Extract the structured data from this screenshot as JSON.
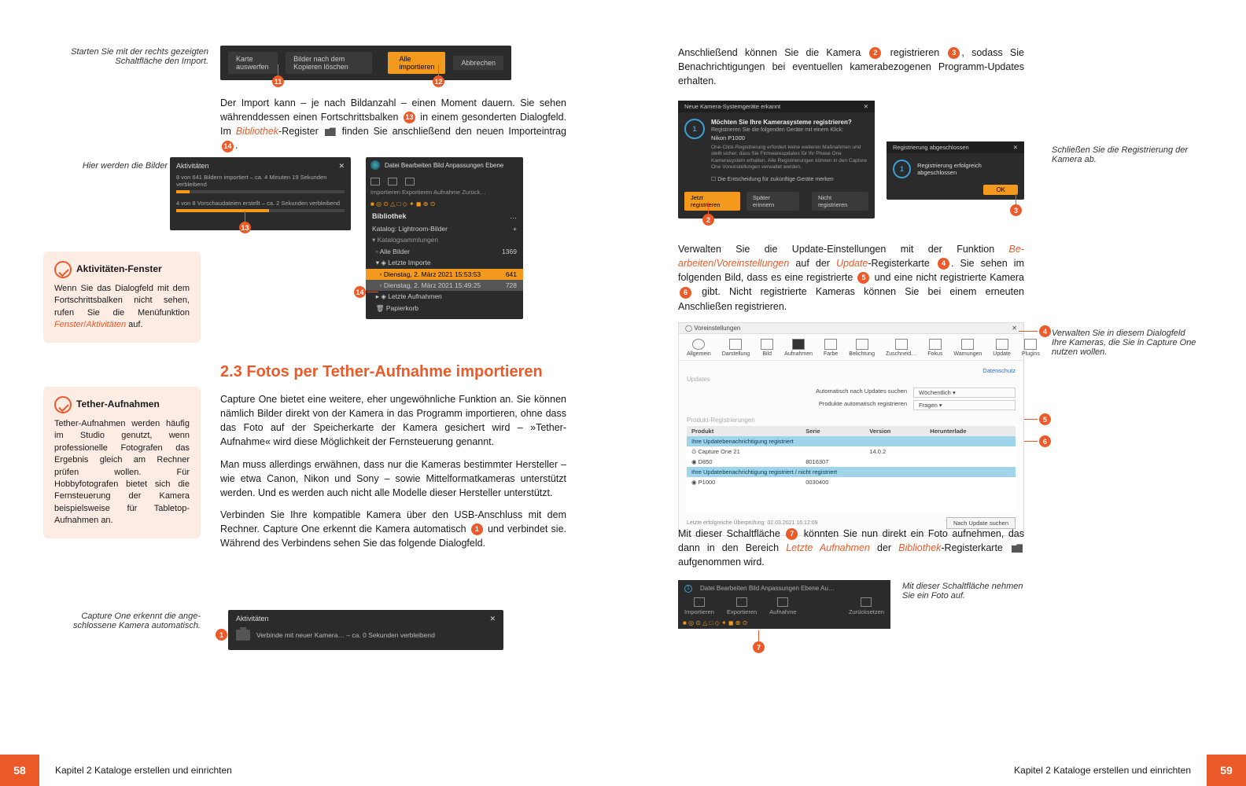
{
  "left": {
    "margin1": "Starten Sie mit der rechts gezeigten Schaltfläche den Import.",
    "margin2": "Hier werden die Bilder importiert.",
    "margin3": "Capture One erkennt die ange­schlossene Kamera automatisch.",
    "toolbar": {
      "b1": "Karte auswerfen",
      "b2": "Bilder nach dem Kopieren löschen",
      "b3": "Alle importieren",
      "b4": "Abbrechen"
    },
    "p1a": "Der Import kann – je nach Bildanzahl – einen Moment dauern. Sie sehen währenddessen einen Fortschrittsbalken ",
    "p1b": " in einem gesonderten Dialogfeld. Im ",
    "p1_lib": "Bibliothek",
    "p1c": "-Register ",
    "p1d": " finden Sie anschließend den neuen Importeintrag ",
    "activities": {
      "title": "Aktivitäten",
      "l1": "8 von 641 Bildern importiert – ca. 4 Minuten 19 Sekunden verbleibend",
      "l2": "4 von 8 Vorschaudateien erstellt – ca. 2 Sekunden verbleibend"
    },
    "library": {
      "menu": "Datei   Bearbeiten   Bild   Anpassungen   Ebene",
      "tabs": "Importieren  Exportieren  Aufnahme              Zurück…",
      "title": "Bibliothek",
      "kat": "Katalog: Lightroom-Bilder",
      "grp": "Katalogsammlungen",
      "r1": "Alle Bilder",
      "r1n": "1369",
      "r2": "Letzte Importe",
      "r3": "Dienstag, 2. März 2021 15:53:53",
      "r3n": "641",
      "r4": "Dienstag, 2. März 2021 15:49:25",
      "r4n": "728",
      "r5": "Letzte Aufnahmen",
      "r6": "Papierkorb"
    },
    "tip1": {
      "title": "Aktivitäten-Fenster",
      "body_a": "Wenn Sie das Dialogfeld mit dem Fort­schrittsbalken nicht sehen, rufen Sie die Menüfunktion ",
      "body_f": "Fenster",
      "body_sep": "/",
      "body_ak": "Aktivitäten",
      "body_b": " auf."
    },
    "tip2": {
      "title": "Tether-Aufnahmen",
      "body": "Tether-Aufnahmen werden häufig im Stu­dio genutzt, wenn professionelle Fotogra­fen das Ergebnis gleich am Rechner prüfen wollen. Für Hobbyfotografen bietet sich die Fernsteuerung der Kamera beispielsweise für Tabletop-Aufnahmen an."
    },
    "h2": "2.3   Fotos per Tether-Aufnahme importieren",
    "p2": "Capture One bietet eine weitere, eher ungewöhnliche Funktion an. Sie können nämlich Bilder direkt von der Kamera in das Pro­gramm importieren, ohne dass das Foto auf der Speicherkarte der Kamera gesichert wird – »Tether-Aufnahme« wird diese Möglichkeit der Fernsteuerung genannt.",
    "p3": "Man muss allerdings erwähnen, dass nur die Kameras bestimm­ter Hersteller – wie etwa Canon, Nikon und Sony – sowie Mittel­formatkameras unterstützt werden. Und es werden auch nicht alle Modelle dieser Hersteller unterstützt.",
    "p4a": "Verbinden Sie Ihre kompatible Kamera über den USB-Anschluss mit dem Rechner. Capture One erkennt die Kamera automatisch ",
    "p4b": " und verbindet sie. Während des Verbindens sehen Sie das folgende Dialogfeld.",
    "connect": {
      "title": "Aktivitäten",
      "text": "Verbinde mit neuer Kamera… – ca. 0 Sekunden verbleibend"
    }
  },
  "right": {
    "p1a": "Anschließend können Sie die Kamera ",
    "p1b": " registrieren ",
    "p1c": ", sodass Sie Benachrichtigungen bei eventuellen kamerabezogenen Pro­gramm-Updates erhalten.",
    "reg": {
      "bar": "Neue Kamera-Systemgeräte erkannt",
      "q": "Möchten Sie Ihre Kamerasysteme registrieren?",
      "l1": "Registrieren Sie die folgenden Geräte mit einem Klick:",
      "cam": "Nikon P1000",
      "l2": "One-Click-Registrierung erfordert keine weiteren Maßnahmen und stellt sicher, dass Sie Firmwareupdates für Ihr Phase One Kamerasystem erhalten. Alle Registrierungen können in den Capture One Voreinstellungen verwaltet werden.",
      "chk": "Die Entscheidung für zukünftige Geräte merken",
      "b1": "Jetzt registrieren",
      "b2": "Später erinnern",
      "b3": "Nicht registrieren"
    },
    "done": {
      "bar": "Registrierung abgeschlossen",
      "msg": "Registrierung erfolgreich abgeschlossen",
      "ok": "OK"
    },
    "margin1": "Schließen Sie die Registrierung der Kamera ab.",
    "p2a": "Verwalten Sie die Update-Einstellungen mit der Funktion ",
    "p2_be": "Be­arbeiten",
    "sep": "/",
    "p2_vor": "Voreinstellungen",
    "p2b": " auf der ",
    "p2_up": "Update",
    "p2c": "-Registerkarte ",
    "p2d": ". Sie sehen im folgenden Bild, dass es eine registrierte ",
    "p2e": " und eine nicht registrierte Kamera ",
    "p2f": " gibt. Nicht registrierte Kame­ras können Sie bei einem erneuten Anschließen registrieren.",
    "margin2": "Verwalten Sie in diesem Dialogfeld Ihre Kameras, die Sie in Capture One nutzen wollen.",
    "pref": {
      "title": "Voreinstellungen",
      "tabs": [
        "Allgemein",
        "Darstellung",
        "Bild",
        "Aufnahmen",
        "Farbe",
        "Belichtung",
        "Zuschneid…",
        "Fokus",
        "Warnungen",
        "Update",
        "Plugins"
      ],
      "link": "Datenschutz",
      "upd": "Updates",
      "row1l": "Automatisch nach Updates suchen",
      "row1v": "Wöchentlich",
      "row2l": "Produkte automatisch registrieren",
      "row2v": "Fragen",
      "sec": "Produkt-Registrierungen",
      "th": [
        "Produkt",
        "Serie",
        "Version",
        "Herunterlade"
      ],
      "blue1": "Ihre Updatebenachrichtigung registriert",
      "r1": [
        "Capture One 21",
        "",
        "14.0.2",
        ""
      ],
      "r2": [
        "D850",
        "8016307",
        "",
        ""
      ],
      "blue2": "Ihre Updatebenachrichtigung registriert / nicht registriert",
      "r3": [
        "P1000",
        "0030400",
        "",
        ""
      ],
      "foot": "Letzte erfolgreiche Überprüfung: 02.03.2021 16:12:09",
      "btn": "Nach Update suchen"
    },
    "p3a": "Mit dieser Schaltfläche ",
    "p3b": " könnten Sie nun direkt ein Foto auf­nehmen, das dann in den Bereich ",
    "p3_la": "Letzte Aufnahmen",
    "p3c": " der ",
    "p3_bib": "Bib­liothek",
    "p3d": "-Registerkarte ",
    "p3e": " aufgenommen wird.",
    "margin3": "Mit dieser Schaltfläche nehmen Sie ein Foto auf.",
    "toolbar2": {
      "menu": "Datei   Bearbeiten   Bild   Anpassungen   Ebene   Au…",
      "items": [
        "Importieren",
        "Exportieren",
        "Aufnahme",
        "Zurücksetzen"
      ]
    }
  },
  "footer": {
    "left_num": "58",
    "right_num": "59",
    "text": "Kapitel 2   Kataloge erstellen und einrichten"
  }
}
